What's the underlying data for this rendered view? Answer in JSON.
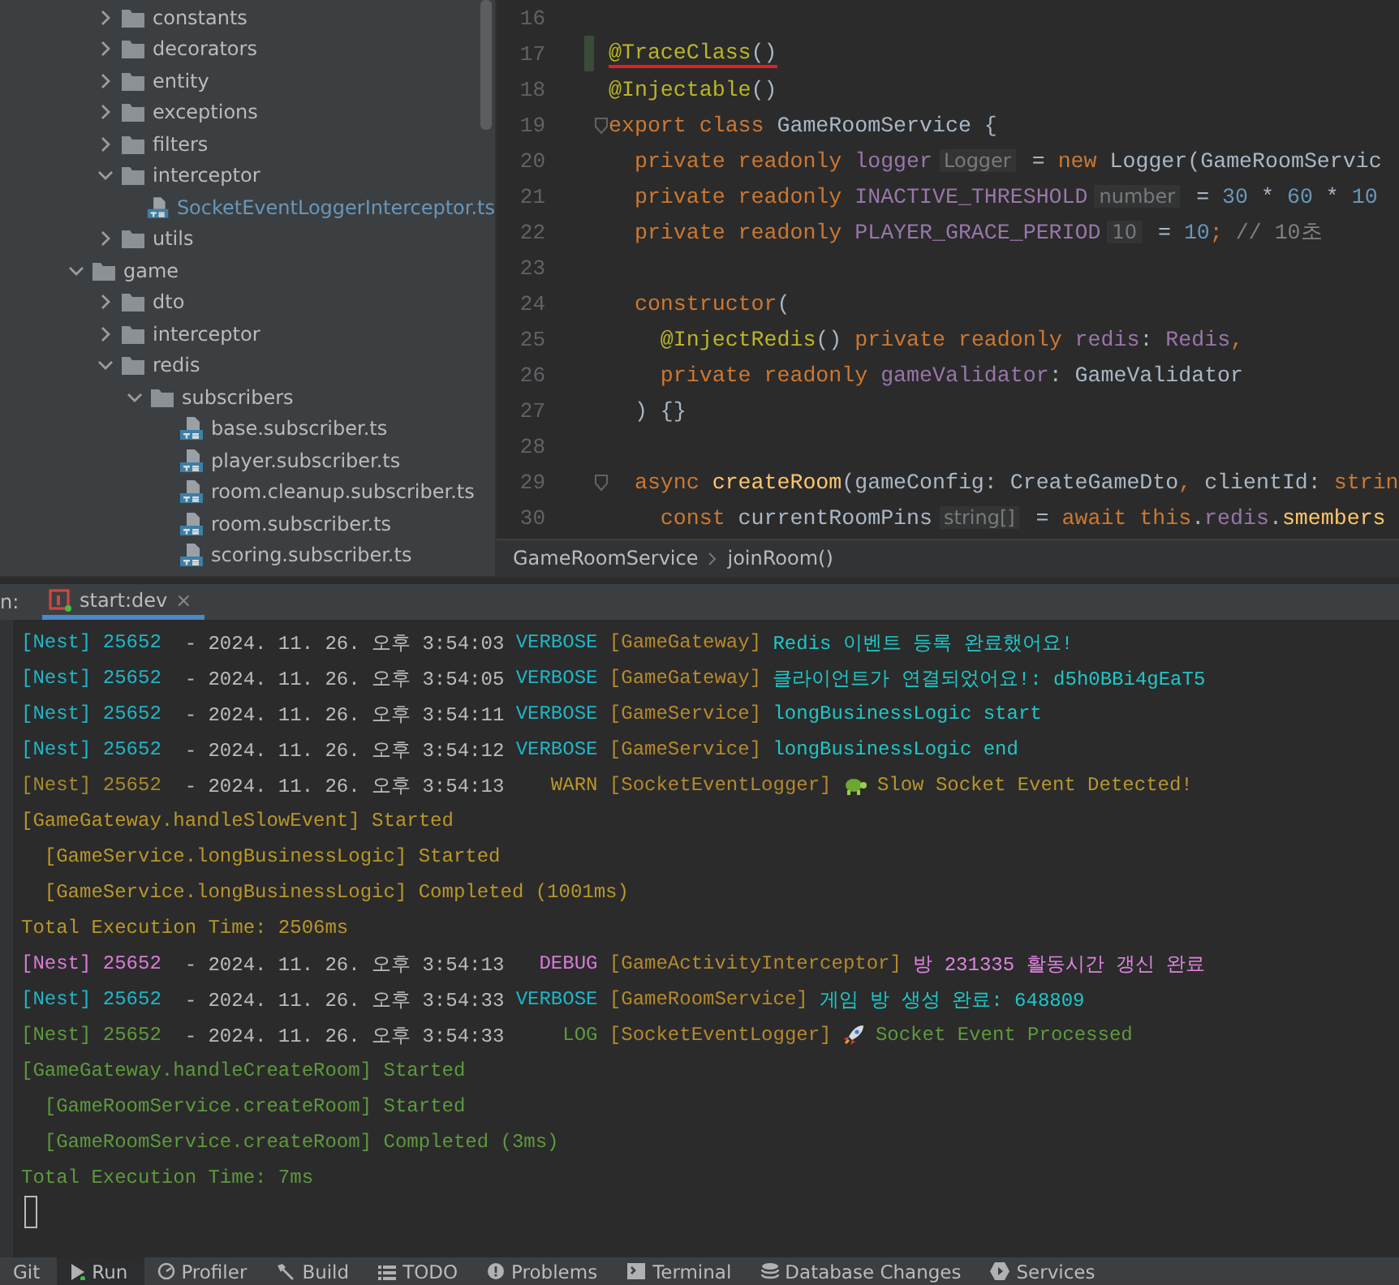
{
  "project_tree": {
    "partial_children": [
      {
        "kind": "folder",
        "label": "constants",
        "expanded": false
      },
      {
        "kind": "folder",
        "label": "decorators",
        "expanded": false
      },
      {
        "kind": "folder",
        "label": "entity",
        "expanded": false
      },
      {
        "kind": "folder",
        "label": "exceptions",
        "expanded": false
      },
      {
        "kind": "folder",
        "label": "filters",
        "expanded": false
      },
      {
        "kind": "folder",
        "label": "interceptor",
        "expanded": true,
        "children": [
          {
            "kind": "file",
            "label": "SocketEventLoggerInterceptor.ts",
            "added": true
          }
        ]
      },
      {
        "kind": "folder",
        "label": "utils",
        "expanded": false
      }
    ],
    "items": [
      {
        "kind": "folder",
        "label": "game",
        "expanded": true,
        "children": [
          {
            "kind": "folder",
            "label": "dto",
            "expanded": false
          },
          {
            "kind": "folder",
            "label": "interceptor",
            "expanded": false
          },
          {
            "kind": "folder",
            "label": "redis",
            "expanded": true,
            "children": [
              {
                "kind": "folder",
                "label": "subscribers",
                "expanded": true,
                "children": [
                  {
                    "kind": "file",
                    "label": "base.subscriber.ts",
                    "added": false
                  },
                  {
                    "kind": "file",
                    "label": "player.subscriber.ts",
                    "added": false
                  },
                  {
                    "kind": "file",
                    "label": "room.cleanup.subscriber.ts",
                    "added": false
                  },
                  {
                    "kind": "file",
                    "label": "room.subscriber.ts",
                    "added": false
                  },
                  {
                    "kind": "file",
                    "label": "scoring.subscriber.ts",
                    "added": false
                  }
                ]
              }
            ]
          }
        ]
      }
    ]
  },
  "editor": {
    "lines": [
      {
        "number": "16",
        "changed": false,
        "underlined": false,
        "fold": false
      },
      {
        "number": "17",
        "changed": true,
        "underlined": true,
        "fold": false,
        "tokens": [
          {
            "kind": "decorator",
            "text": "@TraceClass"
          },
          {
            "kind": "plain",
            "text": "()"
          }
        ]
      },
      {
        "number": "18",
        "changed": false,
        "underlined": false,
        "fold": false,
        "tokens": [
          {
            "kind": "decorator",
            "text": "@Injectable"
          },
          {
            "kind": "plain",
            "text": "()"
          }
        ]
      },
      {
        "number": "19",
        "changed": false,
        "underlined": false,
        "fold": true,
        "tokens": [
          {
            "kind": "keyword",
            "text": "export class "
          },
          {
            "kind": "plain",
            "text": "GameRoomService {"
          }
        ]
      },
      {
        "number": "20",
        "changed": false,
        "underlined": false,
        "fold": false,
        "tokens": [
          {
            "kind": "keyword",
            "text": "  private readonly "
          },
          {
            "kind": "field",
            "text": "logger"
          },
          {
            "kind": "hint",
            "text": "Logger"
          },
          {
            "kind": "plain",
            "text": " = "
          },
          {
            "kind": "keyword",
            "text": "new "
          },
          {
            "kind": "plain",
            "text": "Logger(GameRoomServic"
          }
        ]
      },
      {
        "number": "21",
        "changed": false,
        "underlined": false,
        "fold": false,
        "tokens": [
          {
            "kind": "keyword",
            "text": "  private readonly "
          },
          {
            "kind": "field",
            "text": "INACTIVE_THRESHOLD"
          },
          {
            "kind": "hint",
            "text": "number"
          },
          {
            "kind": "plain",
            "text": " = "
          },
          {
            "kind": "number",
            "text": "30"
          },
          {
            "kind": "plain",
            "text": " * "
          },
          {
            "kind": "number",
            "text": "60"
          },
          {
            "kind": "plain",
            "text": " * "
          },
          {
            "kind": "number",
            "text": "10"
          }
        ]
      },
      {
        "number": "22",
        "changed": false,
        "underlined": false,
        "fold": false,
        "tokens": [
          {
            "kind": "keyword",
            "text": "  private readonly "
          },
          {
            "kind": "field",
            "text": "PLAYER_GRACE_PERIOD"
          },
          {
            "kind": "hint",
            "text": "10"
          },
          {
            "kind": "plain",
            "text": " = "
          },
          {
            "kind": "number",
            "text": "10"
          },
          {
            "kind": "keyword",
            "text": ";"
          },
          {
            "kind": "comment",
            "text": " // 10초"
          }
        ]
      },
      {
        "number": "23",
        "changed": false,
        "underlined": false,
        "fold": false
      },
      {
        "number": "24",
        "changed": false,
        "underlined": false,
        "fold": false,
        "tokens": [
          {
            "kind": "keyword",
            "text": "  constructor"
          },
          {
            "kind": "plain",
            "text": "("
          }
        ]
      },
      {
        "number": "25",
        "changed": false,
        "underlined": false,
        "fold": false,
        "tokens": [
          {
            "kind": "decorator",
            "text": "    @InjectRedis"
          },
          {
            "kind": "plain",
            "text": "() "
          },
          {
            "kind": "keyword",
            "text": "private readonly "
          },
          {
            "kind": "field",
            "text": "redis"
          },
          {
            "kind": "plain",
            "text": ": "
          },
          {
            "kind": "field",
            "text": "Redis"
          },
          {
            "kind": "keyword",
            "text": ","
          }
        ]
      },
      {
        "number": "26",
        "changed": false,
        "underlined": false,
        "fold": false,
        "tokens": [
          {
            "kind": "keyword",
            "text": "    private readonly "
          },
          {
            "kind": "field",
            "text": "gameValidator"
          },
          {
            "kind": "plain",
            "text": ": GameValidator"
          }
        ]
      },
      {
        "number": "27",
        "changed": false,
        "underlined": false,
        "fold": false,
        "tokens": [
          {
            "kind": "plain",
            "text": "  ) {}"
          }
        ]
      },
      {
        "number": "28",
        "changed": false,
        "underlined": false,
        "fold": false
      },
      {
        "number": "29",
        "changed": false,
        "underlined": false,
        "fold": true,
        "tokens": [
          {
            "kind": "keyword",
            "text": "  async "
          },
          {
            "kind": "function",
            "text": "createRoom"
          },
          {
            "kind": "plain",
            "text": "(gameConfig: CreateGameDto"
          },
          {
            "kind": "keyword",
            "text": ", "
          },
          {
            "kind": "plain",
            "text": "clientId: "
          },
          {
            "kind": "keyword",
            "text": "strin"
          }
        ]
      },
      {
        "number": "30",
        "changed": false,
        "underlined": false,
        "fold": false,
        "tokens": [
          {
            "kind": "keyword",
            "text": "    const "
          },
          {
            "kind": "plain",
            "text": "currentRoomPins"
          },
          {
            "kind": "hint",
            "text": "string[]"
          },
          {
            "kind": "plain",
            "text": " = "
          },
          {
            "kind": "keyword",
            "text": "await this"
          },
          {
            "kind": "plain",
            "text": "."
          },
          {
            "kind": "field",
            "text": "redis"
          },
          {
            "kind": "plain",
            "text": "."
          },
          {
            "kind": "function",
            "text": "smembers"
          }
        ]
      }
    ]
  },
  "breadcrumb": [
    "GameRoomService",
    "joinRoom()"
  ],
  "run_panel": {
    "label": "n:",
    "tab": {
      "label": "start:dev",
      "close": "×"
    }
  },
  "console": {
    "lines": [
      {
        "kind": "verbose",
        "prefix": "[Nest] 25652",
        "time": "- 2024. 11. 26. 오후 3:54:03",
        "level": "VERBOSE",
        "context": "[GameGateway]",
        "message": "Redis 이벤트 등록 완료했어요!"
      },
      {
        "kind": "verbose",
        "prefix": "[Nest] 25652",
        "time": "- 2024. 11. 26. 오후 3:54:05",
        "level": "VERBOSE",
        "context": "[GameGateway]",
        "message": "클라이언트가 연결되었어요!: d5h0BBi4gEaT5"
      },
      {
        "kind": "verbose",
        "prefix": "[Nest] 25652",
        "time": "- 2024. 11. 26. 오후 3:54:11",
        "level": "VERBOSE",
        "context": "[GameService]",
        "message": "longBusinessLogic start"
      },
      {
        "kind": "verbose",
        "prefix": "[Nest] 25652",
        "time": "- 2024. 11. 26. 오후 3:54:12",
        "level": "VERBOSE",
        "context": "[GameService]",
        "message": "longBusinessLogic end"
      },
      {
        "kind": "warn",
        "prefix": "[Nest] 25652",
        "time": "- 2024. 11. 26. 오후 3:54:13",
        "level": "WARN",
        "context": "[SocketEventLogger]",
        "message": "Slow Socket Event Detected!"
      },
      {
        "kind": "warn",
        "text": "[GameGateway.handleSlowEvent] Started"
      },
      {
        "kind": "warn",
        "text": "  [GameService.longBusinessLogic] Started"
      },
      {
        "kind": "warn",
        "text": "  [GameService.longBusinessLogic] Completed (1001ms)"
      },
      {
        "kind": "warn",
        "text": "Total Execution Time: 2506ms"
      },
      {
        "kind": "debug",
        "prefix": "[Nest] 25652",
        "time": "- 2024. 11. 26. 오후 3:54:13",
        "level": "DEBUG",
        "context": "[GameActivityInterceptor]",
        "message": "방 231335 활동시간 갱신 완료"
      },
      {
        "kind": "verbose",
        "prefix": "[Nest] 25652",
        "time": "- 2024. 11. 26. 오후 3:54:33",
        "level": "VERBOSE",
        "context": "[GameRoomService]",
        "message": "게임 방 생성 완료: 648809"
      },
      {
        "kind": "log",
        "prefix": "[Nest] 25652",
        "time": "- 2024. 11. 26. 오후 3:54:33",
        "level": "LOG",
        "context": "[SocketEventLogger]",
        "message": "Socket Event Processed"
      },
      {
        "kind": "log",
        "text": "[GameGateway.handleCreateRoom] Started"
      },
      {
        "kind": "log",
        "text": "  [GameRoomService.createRoom] Started"
      },
      {
        "kind": "log",
        "text": "  [GameRoomService.createRoom] Completed (3ms)"
      },
      {
        "kind": "log",
        "text": "Total Execution Time: 7ms"
      }
    ]
  },
  "tool_windows": [
    {
      "kind": "git",
      "label": "Git",
      "selected": false
    },
    {
      "kind": "run",
      "label": "Run",
      "selected": true
    },
    {
      "kind": "profiler",
      "label": "Profiler",
      "selected": false
    },
    {
      "kind": "build",
      "label": "Build",
      "selected": false
    },
    {
      "kind": "todo",
      "label": "TODO",
      "selected": false
    },
    {
      "kind": "problems",
      "label": "Problems",
      "selected": false
    },
    {
      "kind": "terminal",
      "label": "Terminal",
      "selected": false
    },
    {
      "kind": "database",
      "label": "Database Changes",
      "selected": false
    },
    {
      "kind": "services",
      "label": "Services",
      "selected": false
    }
  ]
}
